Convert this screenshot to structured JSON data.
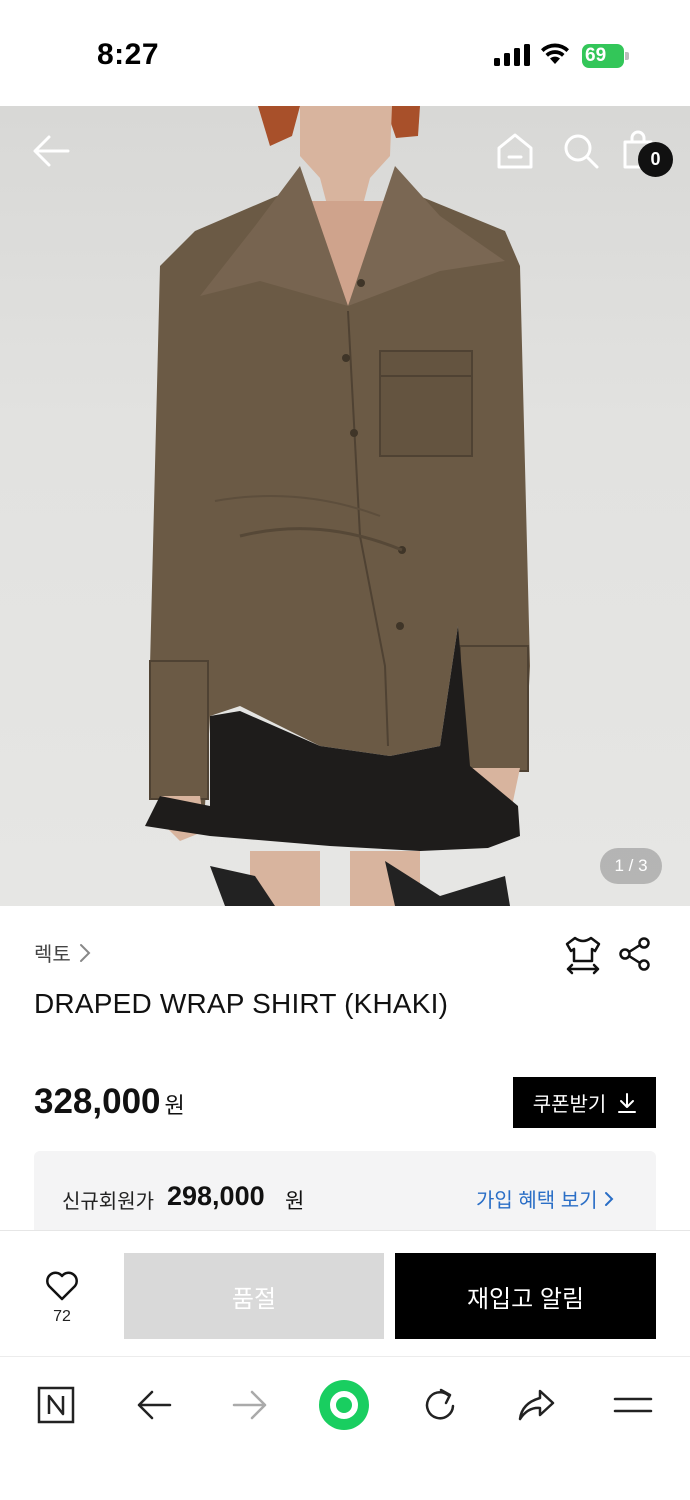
{
  "status_bar": {
    "time": "8:27",
    "battery_level": "69",
    "signal_icon": "cellular-signal-icon",
    "wifi_icon": "wifi-icon"
  },
  "header": {
    "back_icon": "arrow-left-icon",
    "home_icon": "home-icon",
    "search_icon": "search-icon",
    "cart_icon": "shopping-bag-icon",
    "cart_count": "0"
  },
  "gallery": {
    "indicator": "1 / 3"
  },
  "product": {
    "brand": "렉토",
    "title": "DRAPED WRAP SHIRT (KHAKI)",
    "price": "328,000",
    "price_unit": "원",
    "coupon_label": "쿠폰받기",
    "member_label": "신규회원가",
    "member_price": "298,000",
    "member_unit": "원",
    "member_link": "가입 혜택 보기"
  },
  "actions": {
    "like_count": "72",
    "soldout_label": "품절",
    "restock_label": "재입고 알림"
  },
  "colors": {
    "accent_link": "#2a6ec6",
    "primary_button": "#000000",
    "disabled_button": "#d9d9d9",
    "battery_green": "#33c659",
    "naver_green": "#19ce60"
  }
}
